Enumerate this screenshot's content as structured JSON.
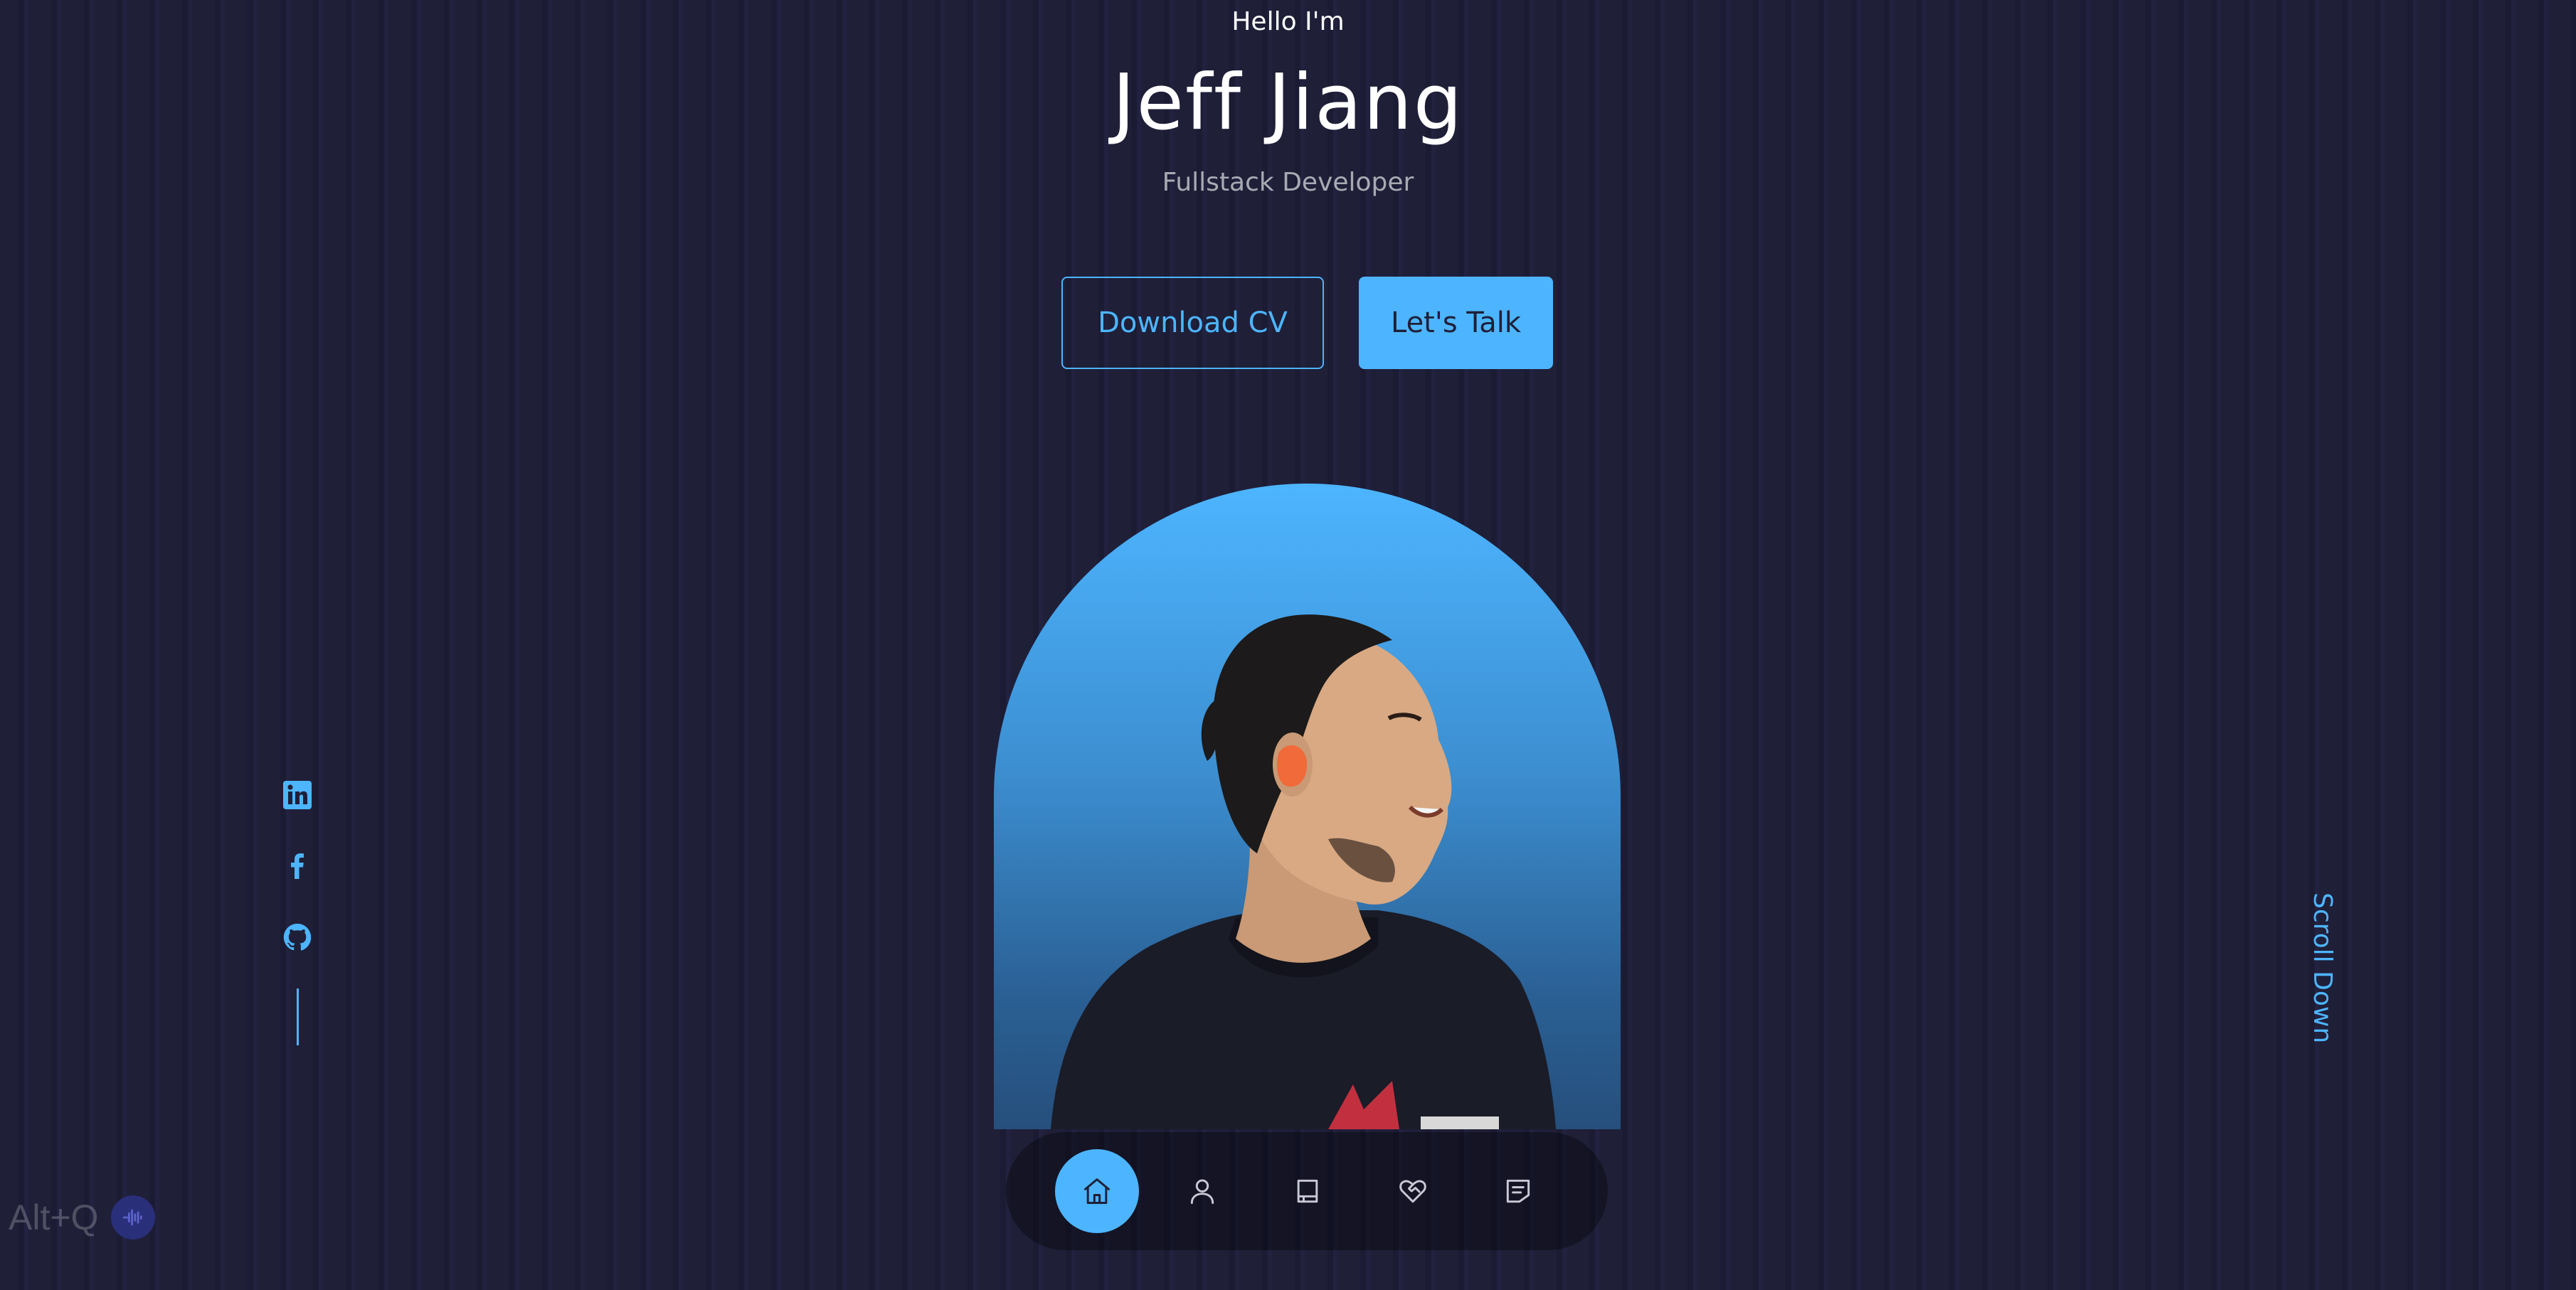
{
  "header": {
    "greeting": "Hello I'm",
    "name": "Jeff Jiang",
    "role": "Fullstack Developer"
  },
  "cta": {
    "download_label": "Download CV",
    "talk_label": "Let's Talk"
  },
  "socials": [
    {
      "icon": "linkedin-icon"
    },
    {
      "icon": "facebook-icon"
    },
    {
      "icon": "github-icon"
    }
  ],
  "scroll": {
    "label": "Scroll Down"
  },
  "nav": {
    "items": [
      {
        "icon": "home-icon",
        "active": true
      },
      {
        "icon": "user-icon",
        "active": false
      },
      {
        "icon": "book-icon",
        "active": false
      },
      {
        "icon": "heart-handshake-icon",
        "active": false
      },
      {
        "icon": "message-icon",
        "active": false
      }
    ]
  },
  "overlay": {
    "shortcut_label": "Alt+Q"
  },
  "colors": {
    "background": "#1f1f38",
    "accent": "#4db5ff",
    "text": "#ffffff",
    "muted_text": "#a3a3b3"
  }
}
